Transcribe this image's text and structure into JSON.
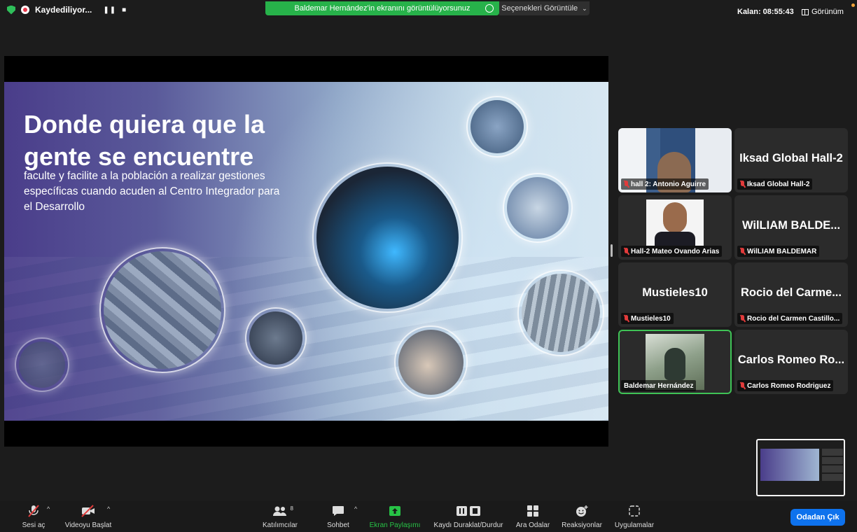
{
  "topbar": {
    "recording_label": "Kaydediliyor...",
    "pause_symbol": "❚❚",
    "stop_symbol": "■",
    "share_banner_text": "Baldemar Hernández'in ekranını görüntülüyorsunuz",
    "view_options_label": "Seçenekleri Görüntüle",
    "remaining_time": "Kalan: 08:55:43",
    "view_label": "Görünüm",
    "accent_color": "#27b24a"
  },
  "slide": {
    "title": "Donde quiera que la gente se encuentre",
    "subtitle": "faculte y facilite a la población a realizar gestiones específicas cuando acuden al Centro Integrador para el Desarrollo"
  },
  "gallery": {
    "tiles": [
      {
        "name": "hall 2: Antonio Aguirre",
        "big_text": "",
        "muted": true,
        "video": true,
        "active": false
      },
      {
        "name": "Iksad Global Hall-2",
        "big_text": "Iksad Global Hall-2",
        "muted": true,
        "video": false,
        "active": false
      },
      {
        "name": "Hall-2 Mateo Ovando Arias",
        "big_text": "",
        "muted": true,
        "video": true,
        "active": false
      },
      {
        "name": "WilLIAM BALDEMAR",
        "big_text": "WilLIAM BALDE...",
        "muted": true,
        "video": false,
        "active": false
      },
      {
        "name": "Mustieles10",
        "big_text": "Mustieles10",
        "muted": true,
        "video": false,
        "active": false
      },
      {
        "name": "Rocio del Carmen Castillo...",
        "big_text": "Rocio del Carme...",
        "muted": true,
        "video": false,
        "active": false
      },
      {
        "name": "Baldemar Hernández",
        "big_text": "",
        "muted": false,
        "video": true,
        "active": true
      },
      {
        "name": "Carlos Romeo Rodriguez",
        "big_text": "Carlos Romeo Ro...",
        "muted": true,
        "video": false,
        "active": false
      }
    ]
  },
  "toolbar": {
    "unmute_label": "Sesi aç",
    "start_video_label": "Videoyu Başlat",
    "participants_label": "Katılımcılar",
    "participants_count": "8",
    "chat_label": "Sohbet",
    "share_screen_label": "Ekran Paylaşımı",
    "record_pause_label": "Kaydı Duraklat/Durdur",
    "breakout_label": "Ara Odalar",
    "reactions_label": "Reaksiyonlar",
    "apps_label": "Uygulamalar",
    "leave_label": "Odadan Çık",
    "leave_color": "#0e72ed"
  }
}
